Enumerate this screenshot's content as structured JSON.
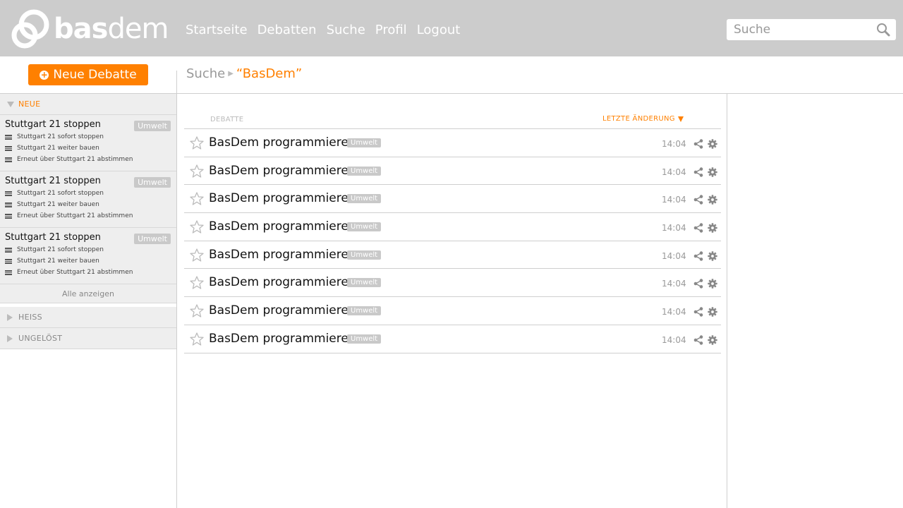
{
  "header": {
    "logo_bold": "bas",
    "logo_light": "dem",
    "nav": [
      "Startseite",
      "Debatten",
      "Suche",
      "Profil",
      "Logout"
    ],
    "search_placeholder": "Suche"
  },
  "subheader": {
    "new_button": "Neue Debatte",
    "breadcrumb_root": "Suche",
    "breadcrumb_current": "“BasDem”"
  },
  "sidebar": {
    "section_new": "NEUE",
    "debates": [
      {
        "title": "Stuttgart 21 stoppen",
        "tag": "Umwelt",
        "options": [
          "Stuttgart 21 sofort stoppen",
          "Stuttgart 21 weiter bauen",
          "Erneut über Stuttgart 21 abstimmen"
        ]
      },
      {
        "title": "Stuttgart 21 stoppen",
        "tag": "Umwelt",
        "options": [
          "Stuttgart 21 sofort stoppen",
          "Stuttgart 21 weiter bauen",
          "Erneut über Stuttgart 21 abstimmen"
        ]
      },
      {
        "title": "Stuttgart 21 stoppen",
        "tag": "Umwelt",
        "options": [
          "Stuttgart 21 sofort stoppen",
          "Stuttgart 21 weiter bauen",
          "Erneut über Stuttgart 21 abstimmen"
        ]
      }
    ],
    "show_all": "Alle anzeigen",
    "section_hot": "HEISS",
    "section_unsolved": "UNGELÖST"
  },
  "table": {
    "col_debate": "DEBATTE",
    "col_changed": "LETZTE ÄNDERUNG",
    "rows": [
      {
        "title": "BasDem programmieren",
        "tag": "Umwelt",
        "time": "14:04"
      },
      {
        "title": "BasDem programmieren",
        "tag": "Umwelt",
        "time": "14:04"
      },
      {
        "title": "BasDem programmieren",
        "tag": "Umwelt",
        "time": "14:04"
      },
      {
        "title": "BasDem programmieren",
        "tag": "Umwelt",
        "time": "14:04"
      },
      {
        "title": "BasDem programmieren",
        "tag": "Umwelt",
        "time": "14:04"
      },
      {
        "title": "BasDem programmieren",
        "tag": "Umwelt",
        "time": "14:04"
      },
      {
        "title": "BasDem programmieren",
        "tag": "Umwelt",
        "time": "14:04"
      },
      {
        "title": "BasDem programmieren",
        "tag": "Umwelt",
        "time": "14:04"
      }
    ]
  },
  "colors": {
    "accent": "#ff8000",
    "header_bg": "#cccccc",
    "tag_bg": "#c9c9c9"
  }
}
